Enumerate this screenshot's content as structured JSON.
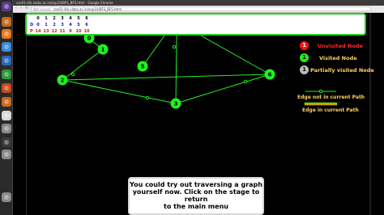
{
  "browser": {
    "window_title": "cse01-iitk.vlabs.ac.in/exp10/BFS_BFS.html - Google Chrome",
    "security_label": "Not secure",
    "url": "cse01-iitk.vlabs.ac.in/exp10/BFS_BFS.html"
  },
  "launcher": {
    "apps": [
      {
        "name": "dash-icon",
        "color": "#5a3a8a"
      },
      {
        "name": "files-icon",
        "color": "#c86a1a"
      },
      {
        "name": "firefox-icon",
        "color": "#e8781a"
      },
      {
        "name": "chrome-icon",
        "color": "#3a8ad8"
      },
      {
        "name": "writer-icon",
        "color": "#2a6ab8"
      },
      {
        "name": "calc-icon",
        "color": "#2a9a3a"
      },
      {
        "name": "impress-icon",
        "color": "#c84a1a"
      },
      {
        "name": "software-center-icon",
        "color": "#c86a1a"
      },
      {
        "name": "amazon-icon",
        "color": "#d8d8d8"
      },
      {
        "name": "settings-icon",
        "color": "#8a8a8a"
      },
      {
        "name": "terminal-icon",
        "color": "#3a3a3a"
      },
      {
        "name": "disk-icon",
        "color": "#8a8a8a"
      },
      {
        "name": "trash-icon",
        "color": "#8a8a8a"
      }
    ]
  },
  "table": {
    "indices": [
      "0",
      "1",
      "2",
      "3",
      "4",
      "5",
      "6"
    ],
    "d_label": "D",
    "d_values": [
      "0",
      "1",
      "2",
      "3",
      "4",
      "5",
      "6"
    ],
    "p_label": "P",
    "p_values": [
      "14",
      "13",
      "12",
      "11",
      "9",
      "10",
      "10"
    ]
  },
  "legend": {
    "unvisited": {
      "symbol": "1",
      "label": "Unvisited Node",
      "color": "#ff1010"
    },
    "visited": {
      "symbol": "1",
      "label": "Visited Node",
      "color": "#22ee22"
    },
    "partial": {
      "symbol": "1",
      "label": "Partially visited Node",
      "color": "#bbbbbb"
    },
    "edge_not": {
      "label": "Edge not in current Path",
      "color": "#22ee22"
    },
    "edge_in": {
      "label": "Edge in current Path",
      "color": "#ff8a00"
    }
  },
  "graph": {
    "node_color": "#22ee22",
    "edge_color": "#22ee22",
    "nodes": [
      {
        "id": "0",
        "label": "0"
      },
      {
        "id": "1",
        "label": "1"
      },
      {
        "id": "2",
        "label": "2"
      },
      {
        "id": "3",
        "label": "3"
      },
      {
        "id": "5",
        "label": "5"
      },
      {
        "id": "6",
        "label": "6"
      }
    ]
  },
  "message": {
    "line1": "You could try out traversing a graph",
    "line2": "yourself now. Click on the stage to return",
    "line3": "to the main menu"
  }
}
